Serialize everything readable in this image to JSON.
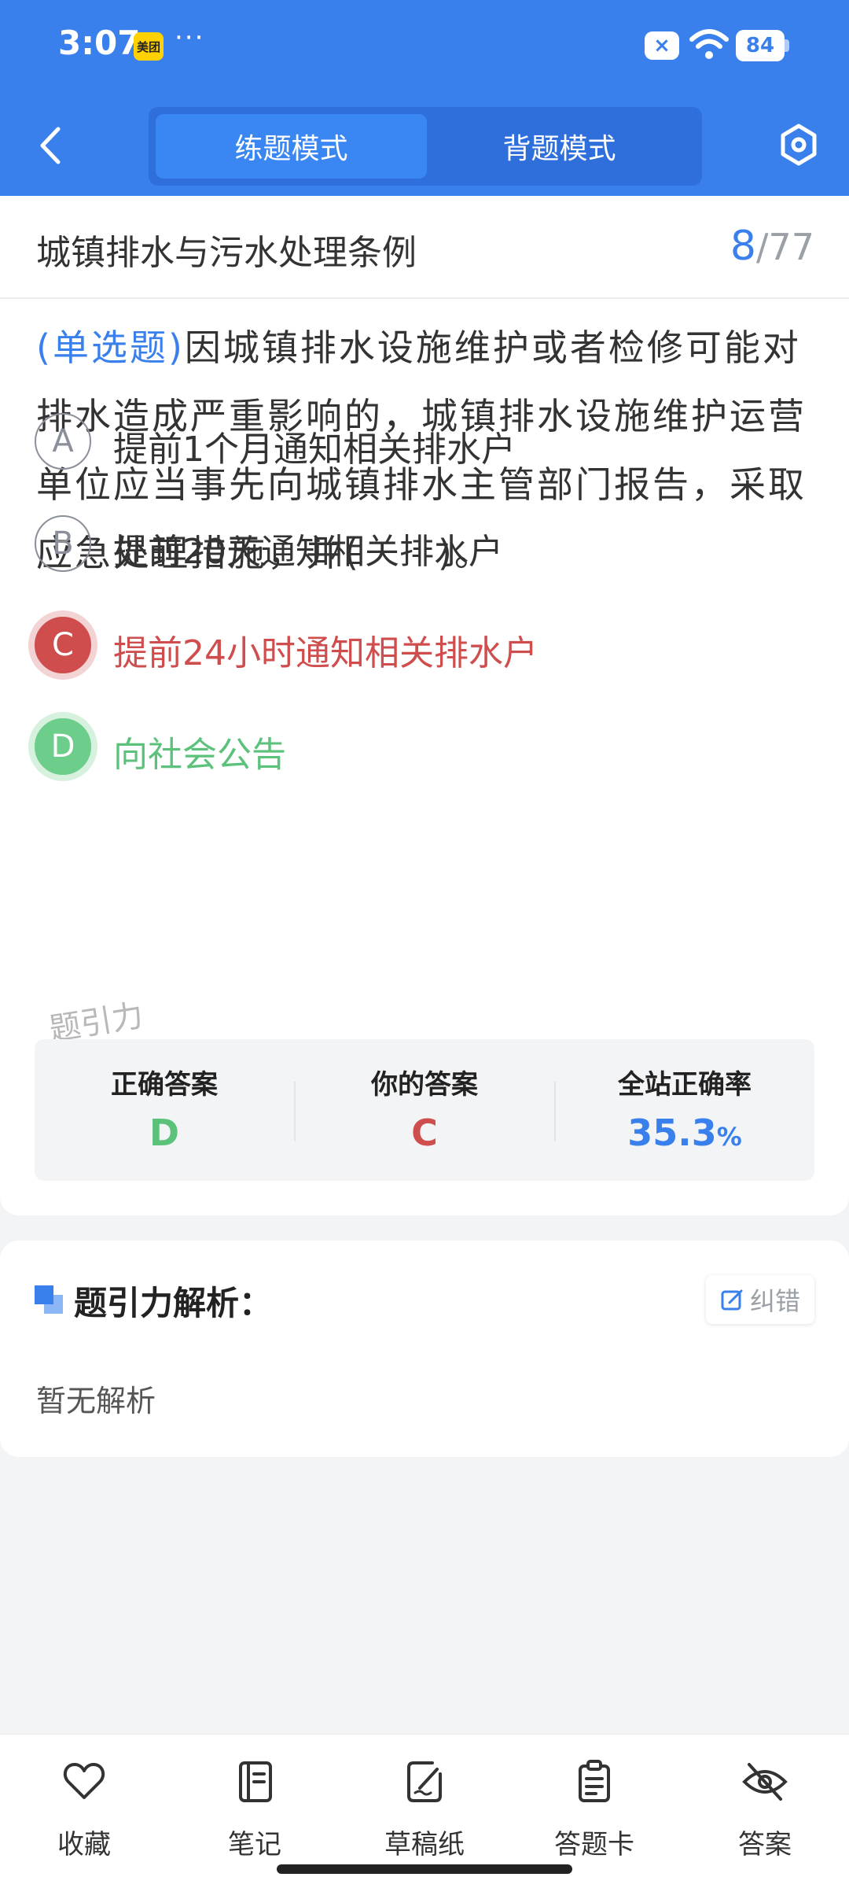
{
  "status_bar": {
    "time": "3:07",
    "app_badge": "美团",
    "more_dots": "···",
    "close_badge": "×",
    "battery": "84"
  },
  "header": {
    "tabs": [
      {
        "label": "练题模式",
        "active": true
      },
      {
        "label": "背题模式",
        "active": false
      }
    ],
    "accent_color": "#3a80ec"
  },
  "question": {
    "category_title": "城镇排水与污水处理条例",
    "current_index": "8",
    "separator": "/",
    "total": "77",
    "type_label": "(单选题)",
    "text": "因城镇排水设施维护或者检修可能对排水造成严重影响的，城镇排水设施维护运营单位应当事先向城镇排水主管部门报告，采取应急处理措施，并(　　)。",
    "options": [
      {
        "letter": "A",
        "text": "提前1个月通知相关排水户",
        "state": "normal"
      },
      {
        "letter": "B",
        "text": "提前20天通知相关排水户",
        "state": "normal"
      },
      {
        "letter": "C",
        "text": "提前24小时通知相关排水户",
        "state": "wrong"
      },
      {
        "letter": "D",
        "text": "向社会公告",
        "state": "correct"
      }
    ],
    "watermark": "题引力"
  },
  "stats": {
    "correct_answer_label": "正确答案",
    "correct_answer": "D",
    "your_answer_label": "你的答案",
    "your_answer": "C",
    "accuracy_label": "全站正确率",
    "accuracy_value": "35.3",
    "accuracy_unit": "%"
  },
  "analysis": {
    "title": "题引力解析：",
    "correct_button": "纠错",
    "body": "暂无解析"
  },
  "bottom_bar": {
    "items": [
      {
        "label": "收藏",
        "icon": "heart-icon"
      },
      {
        "label": "笔记",
        "icon": "notebook-icon"
      },
      {
        "label": "草稿纸",
        "icon": "draft-paper-icon"
      },
      {
        "label": "答题卡",
        "icon": "answer-card-icon"
      },
      {
        "label": "答案",
        "icon": "eye-off-icon"
      }
    ]
  }
}
